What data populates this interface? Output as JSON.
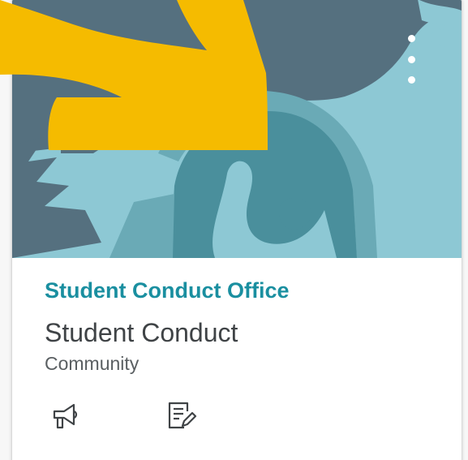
{
  "card": {
    "course_code": "Student Conduct Office",
    "course_name": "Student Conduct",
    "term": "Community",
    "colors": {
      "hero_sky": "#8dc8d4",
      "hero_dark": "#55707f",
      "hero_helmet": "#4a8f9c",
      "course_code": "#1a8fa0",
      "arrow": "#f5bb00"
    }
  },
  "icons": {
    "more_options": "vertical-ellipsis-icon",
    "announcements": "megaphone-icon",
    "assignments": "assignment-pencil-icon"
  }
}
